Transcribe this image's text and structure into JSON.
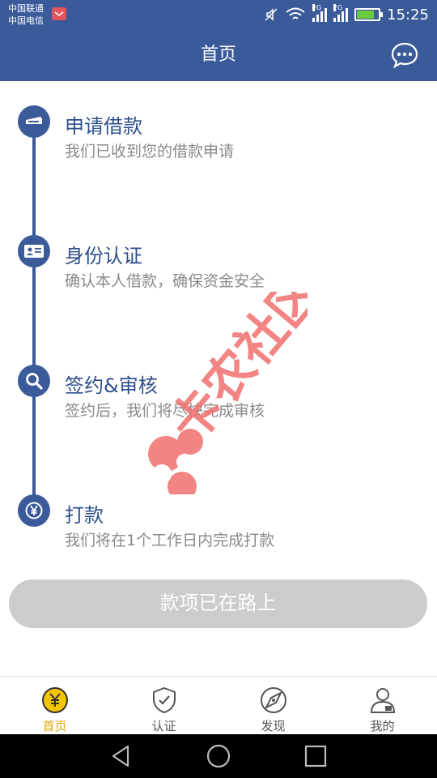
{
  "status_bar": {
    "carrier_1": "中国联通",
    "carrier_2": "中国电信",
    "network_1": "2G",
    "network_2": "2G",
    "time": "15:25",
    "battery_level": 0.8,
    "accent_color": "#3a5a9a"
  },
  "header": {
    "title": "首页",
    "chat_icon": "chat-bubble-icon"
  },
  "steps": [
    {
      "title": "申请借款",
      "desc": "我们已收到您的借款申请",
      "icon": "loan-application-icon"
    },
    {
      "title": "身份认证",
      "desc": "确认本人借款，确保资金安全",
      "icon": "id-card-icon"
    },
    {
      "title": "签约&审核",
      "desc": "签约后，我们将尽快完成审核",
      "icon": "search-icon"
    },
    {
      "title": "打款",
      "desc": "我们将在1个工作日内完成打款",
      "icon": "yen-coin-icon"
    }
  ],
  "action_button": {
    "label": "款项已在路上",
    "color": "#cccccc"
  },
  "watermark": {
    "text": "卡农社区",
    "color": "#f06f6f"
  },
  "tabbar": {
    "active_color": "#e0a500",
    "tabs": [
      {
        "label": "首页",
        "icon": "home-yen-icon",
        "active": true
      },
      {
        "label": "认证",
        "icon": "shield-check-icon",
        "active": false
      },
      {
        "label": "发现",
        "icon": "compass-icon",
        "active": false
      },
      {
        "label": "我的",
        "icon": "user-profile-icon",
        "active": false
      }
    ]
  },
  "system_nav": {
    "back_icon": "back-triangle-icon",
    "home_icon": "home-circle-icon",
    "recents_icon": "recents-square-icon"
  }
}
